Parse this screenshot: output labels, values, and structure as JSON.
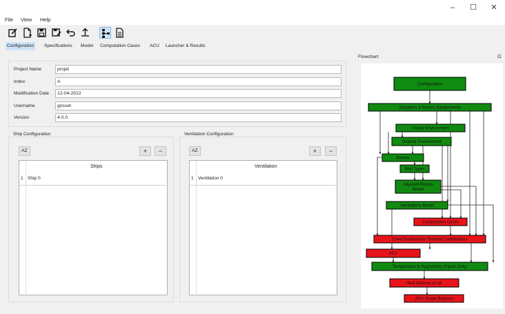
{
  "window": {
    "minimize_glyph": "–",
    "maximize_glyph": "☐",
    "close_glyph": "✕"
  },
  "menu": [
    "File",
    "View",
    "Help"
  ],
  "toolbar": {
    "icons": [
      "new-file-icon",
      "new-document-icon",
      "save-icon",
      "save-as-icon",
      "undo-icon",
      "upload-icon",
      "flowchart-icon",
      "document-icon"
    ]
  },
  "tabs": [
    "Configuration",
    "Specifications",
    "Model",
    "Computation Cases",
    "ACU",
    "Launcher & Results"
  ],
  "project": {
    "fields": [
      {
        "label": "Project Name",
        "value": "projet"
      },
      {
        "label": "Index",
        "value": "A"
      },
      {
        "label": "Modification Date",
        "value": "12-04-2022"
      },
      {
        "label": "Username",
        "value": "gosset"
      },
      {
        "label": "Version",
        "value": "4.0.0"
      }
    ]
  },
  "ship_config": {
    "title": "Ship Configuration",
    "sort_label": "AZ",
    "add_label": "+",
    "remove_label": "−",
    "column": "Ships",
    "rows": [
      {
        "num": "1",
        "name": "Ship 0"
      }
    ]
  },
  "vent_config": {
    "title": "Ventilation Configuration",
    "sort_label": "AZ",
    "add_label": "+",
    "remove_label": "−",
    "column": "Ventilation",
    "rows": [
      {
        "num": "1",
        "name": "Ventilation 0"
      }
    ]
  },
  "flowchart": {
    "title": "Flowchart",
    "pin_glyph": "⊡",
    "colors": {
      "green": "#118a11",
      "red": "#e8141a",
      "border": "#000000"
    },
    "nodes": [
      {
        "label": "Configuration",
        "status": "green"
      },
      {
        "label": "Situations & Rooms Equipements",
        "status": "green"
      },
      {
        "label": "Indoor Environment",
        "status": "green"
      },
      {
        "label": "Outdoor Environment",
        "status": "green"
      },
      {
        "label": "Rooms",
        "status": "green"
      },
      {
        "label": "Wall Types",
        "status": "green"
      },
      {
        "label": "Adjacent Rooms",
        "label2": "Model",
        "status": "green"
      },
      {
        "label": "Ventilations Model",
        "status": "green"
      },
      {
        "label": "Computation Cases",
        "status": "red"
      },
      {
        "label": "Crew Distributions Thermal Contributions",
        "status": "red"
      },
      {
        "label": "ACU",
        "status": "red"
      },
      {
        "label": "Temperature & Hygrometry (Inputs Only)",
        "status": "green"
      },
      {
        "label": "Heat balance on air",
        "status": "red"
      },
      {
        "label": "ACU Power Balance",
        "status": "red"
      }
    ]
  }
}
